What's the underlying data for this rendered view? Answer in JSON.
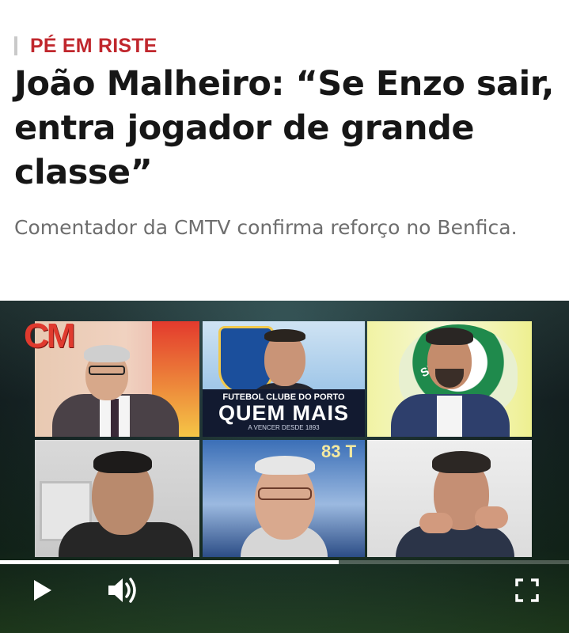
{
  "article": {
    "kicker": "PÉ EM RISTE",
    "title": "João Malheiro: “Se Enzo sair, entra jogador de grande classe”",
    "lead": "Comentador da CMTV confirma reforço no Benfica."
  },
  "video": {
    "channel_logo": "CM",
    "banner_club": "FUTEBOL CLUBE DO PORTO",
    "banner_slogan": "QUEM MAIS",
    "banner_sub": "A VENCER DESDE 1893",
    "banner_number": "83 T",
    "crest_right_text": "SPORTING",
    "progress": 0.595,
    "controls": {
      "play": "play-icon",
      "volume": "volume-icon",
      "fullscreen": "fullscreen-icon"
    }
  },
  "colors": {
    "kicker": "#c0272d",
    "headline": "#161616",
    "lead": "#6e6e6e"
  }
}
